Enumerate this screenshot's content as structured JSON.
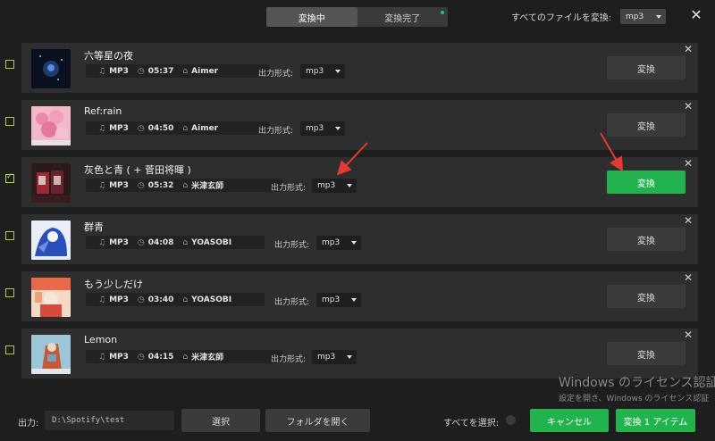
{
  "header": {
    "tabs": [
      {
        "label": "変換中",
        "active": true
      },
      {
        "label": "変換完了",
        "active": false
      }
    ],
    "all_files_label": "すべてのファイルを変換:",
    "all_files_format": "mp3",
    "close_icon": "close-icon"
  },
  "items": [
    {
      "title": "六等星の夜",
      "format": "MP3",
      "duration": "05:37",
      "artist": "Aimer",
      "output_label": "出力形式:",
      "output_format": "mp3",
      "convert_label": "変換",
      "checked": false
    },
    {
      "title": "Ref:rain",
      "format": "MP3",
      "duration": "04:50",
      "artist": "Aimer",
      "output_label": "出力形式:",
      "output_format": "mp3",
      "convert_label": "変換",
      "checked": false
    },
    {
      "title": "灰色と青 ( + 菅田将暉 )",
      "format": "MP3",
      "duration": "05:32",
      "artist": "米津玄師",
      "output_label": "出力形式:",
      "output_format": "mp3",
      "convert_label": "変換",
      "checked": true
    },
    {
      "title": "群青",
      "format": "MP3",
      "duration": "04:08",
      "artist": "YOASOBI",
      "output_label": "出力形式:",
      "output_format": "mp3",
      "convert_label": "変換",
      "checked": false
    },
    {
      "title": "もう少しだけ",
      "format": "MP3",
      "duration": "03:40",
      "artist": "YOASOBI",
      "output_label": "出力形式:",
      "output_format": "mp3",
      "convert_label": "変換",
      "checked": false
    },
    {
      "title": "Lemon",
      "format": "MP3",
      "duration": "04:15",
      "artist": "米津玄師",
      "output_label": "出力形式:",
      "output_format": "mp3",
      "convert_label": "変換",
      "checked": false
    }
  ],
  "footer": {
    "output_label": "出力:",
    "output_path": "D:\\Spotify\\test",
    "select_label": "選択",
    "open_folder_label": "フォルダを開く",
    "select_all_label": "すべてを選択:",
    "cancel_label": "キャンセル",
    "convert_items_label": "変換 1 アイテム"
  },
  "watermark": {
    "line1": "Windows のライセンス認証",
    "line2": "設定を開き、Windows のライセンス認証"
  },
  "colors": {
    "accent_green": "#22b34f",
    "background": "#1e1e1e",
    "row_background": "#2e2e2e",
    "annotation_red": "#e53935"
  }
}
